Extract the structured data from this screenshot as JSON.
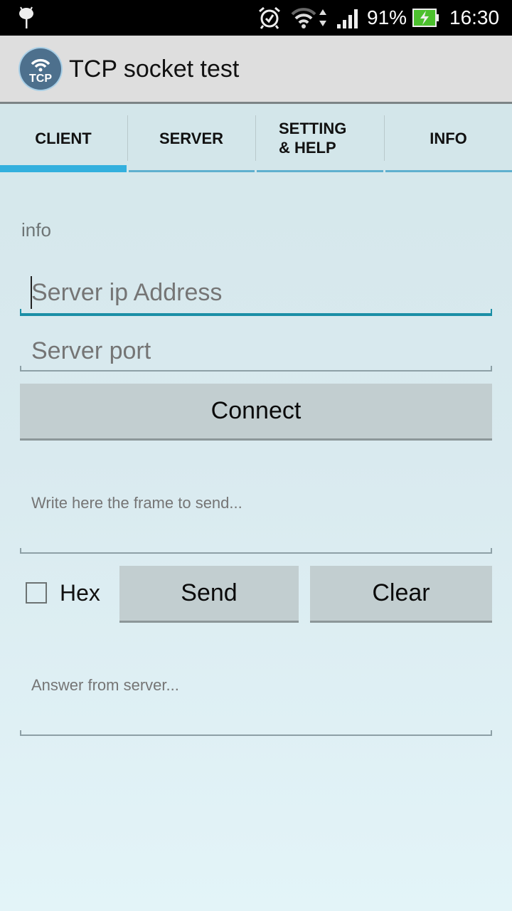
{
  "status_bar": {
    "battery": "91%",
    "time": "16:30",
    "icons": [
      "android-debug-icon",
      "alarm-icon",
      "wifi-icon",
      "data-arrows-icon",
      "signal-icon",
      "battery-charging-icon"
    ]
  },
  "app": {
    "title": "TCP socket test",
    "logo_text": "TCP"
  },
  "tabs": [
    {
      "label": "CLIENT",
      "active": true
    },
    {
      "label": "SERVER",
      "active": false
    },
    {
      "label": "SETTING & HELP",
      "line1": "SETTING",
      "line2": "& HELP",
      "active": false
    },
    {
      "label": "INFO",
      "active": false
    }
  ],
  "client": {
    "info_label": "info",
    "server_ip": {
      "value": "",
      "placeholder": "Server ip Address"
    },
    "server_port": {
      "value": "",
      "placeholder": "Server port"
    },
    "connect_label": "Connect",
    "frame": {
      "value": "",
      "placeholder": "Write here the frame to send..."
    },
    "hex_label": "Hex",
    "hex_checked": false,
    "send_label": "Send",
    "clear_label": "Clear",
    "answer": {
      "value": "",
      "placeholder": "Answer from server..."
    }
  },
  "colors": {
    "accent": "#33b0de",
    "focus_underline": "#1b8fa6",
    "battery": "#4cc02e"
  }
}
